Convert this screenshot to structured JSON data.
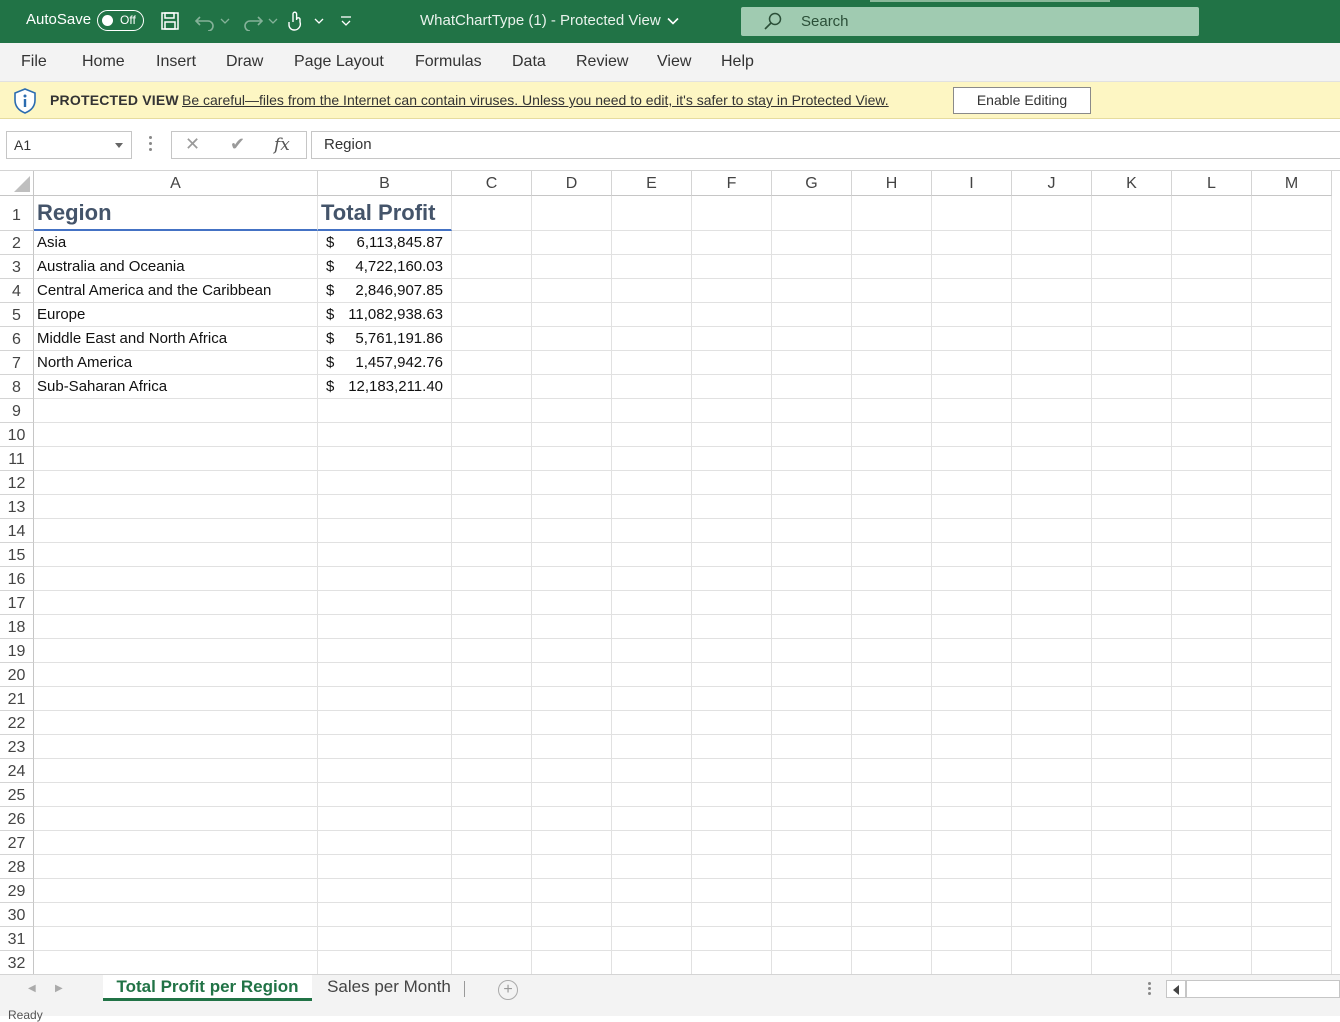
{
  "titlebar": {
    "autosave_label": "AutoSave",
    "autosave_state": "Off",
    "doc_title": "WhatChartType (1)  -  Protected View",
    "search_placeholder": "Search"
  },
  "menu": [
    "File",
    "Home",
    "Insert",
    "Draw",
    "Page Layout",
    "Formulas",
    "Data",
    "Review",
    "View",
    "Help"
  ],
  "protected_view": {
    "label": "PROTECTED VIEW",
    "message": "Be careful—files from the Internet can contain viruses. Unless you need to edit, it's safer to stay in Protected View.",
    "button": "Enable Editing"
  },
  "formula_bar": {
    "name_box": "A1",
    "cancel": "✕",
    "enter": "✔",
    "fx": "fx",
    "content": "Region"
  },
  "grid": {
    "columns": [
      "A",
      "B",
      "C",
      "D",
      "E",
      "F",
      "G",
      "H",
      "I",
      "J",
      "K",
      "L",
      "M"
    ],
    "header_row": [
      "Region",
      "Total Profit"
    ],
    "rows": [
      {
        "region": "Asia",
        "currency": "$",
        "profit": "6,113,845.87"
      },
      {
        "region": "Australia and Oceania",
        "currency": "$",
        "profit": "4,722,160.03"
      },
      {
        "region": "Central America and the Caribbean",
        "currency": "$",
        "profit": "2,846,907.85"
      },
      {
        "region": "Europe",
        "currency": "$",
        "profit": "11,082,938.63"
      },
      {
        "region": "Middle East and North Africa",
        "currency": "$",
        "profit": "5,761,191.86"
      },
      {
        "region": "North America",
        "currency": "$",
        "profit": "1,457,942.76"
      },
      {
        "region": "Sub-Saharan Africa",
        "currency": "$",
        "profit": "12,183,211.40"
      }
    ],
    "row_numbers": [
      "1",
      "2",
      "3",
      "4",
      "5",
      "6",
      "7",
      "8",
      "9",
      "10",
      "11",
      "12",
      "13",
      "14",
      "15",
      "16",
      "17",
      "18",
      "19",
      "20",
      "21",
      "22",
      "23",
      "24",
      "25",
      "26",
      "27",
      "28",
      "29",
      "30",
      "31",
      "32"
    ]
  },
  "sheets": {
    "active": "Total Profit per Region",
    "other": "Sales per Month",
    "add": "+"
  },
  "status": {
    "text": "Ready"
  },
  "colors": {
    "excel_green": "#217346",
    "protected_bg": "#fdf6c3",
    "header_text": "#44546a",
    "header_underline": "#4472c4"
  }
}
